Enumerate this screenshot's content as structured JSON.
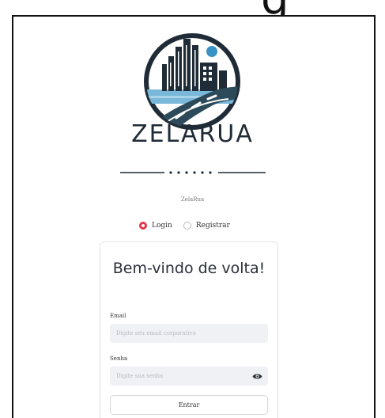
{
  "header": {
    "top_glyph": "g"
  },
  "brand": {
    "name": "ZELARUA",
    "caption": "ZelaRua",
    "colors": {
      "navy": "#1f2b36",
      "road": "#2d4a5a",
      "water": "#79b8d9",
      "sun": "#3a93c4"
    }
  },
  "mode": {
    "options": [
      {
        "label": "Login",
        "selected": true
      },
      {
        "label": "Registrar",
        "selected": false
      }
    ],
    "accent": "#e0374a"
  },
  "login_card": {
    "title": "Bem-vindo de volta!",
    "email": {
      "label": "Email",
      "placeholder": "Digite seu email corporativo",
      "value": ""
    },
    "password": {
      "label": "Senha",
      "placeholder": "Digite sua senha",
      "value": "",
      "toggle_icon": "eye-icon"
    },
    "submit_label": "Entrar"
  }
}
